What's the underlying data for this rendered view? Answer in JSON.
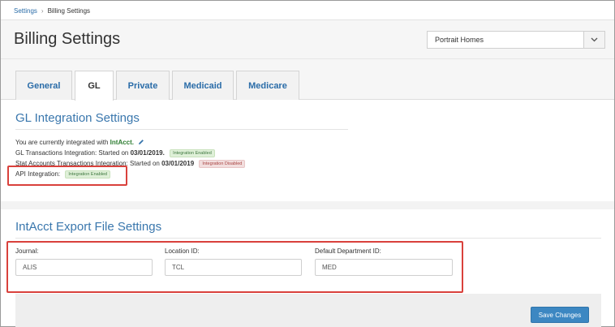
{
  "breadcrumb": {
    "parent": "Settings",
    "separator": "›",
    "current": "Billing Settings"
  },
  "header": {
    "title": "Billing Settings",
    "organization": "Portrait Homes"
  },
  "tabs": [
    {
      "label": "General",
      "active": false
    },
    {
      "label": "GL",
      "active": true
    },
    {
      "label": "Private",
      "active": false
    },
    {
      "label": "Medicaid",
      "active": false
    },
    {
      "label": "Medicare",
      "active": false
    }
  ],
  "gl_section": {
    "title": "GL Integration Settings",
    "integrated_prefix": "You are currently integrated with ",
    "integrated_name": "IntAcct.",
    "gl_transactions_prefix": "GL Transactions Integration: Started on ",
    "gl_transactions_date": "03/01/2019.",
    "gl_transactions_badge": "Integration Enabled",
    "stat_accounts_prefix": "Stat Accounts Transactions Integration: Started on ",
    "stat_accounts_date": "03/01/2019",
    "stat_accounts_badge": "Integration Disabled",
    "api_label": "API Integration:",
    "api_badge": "Integration Enabled"
  },
  "export_section": {
    "title": "IntAcct Export File Settings",
    "journal": {
      "label": "Journal:",
      "value": "ALIS"
    },
    "location": {
      "label": "Location ID:",
      "value": "TCL"
    },
    "department": {
      "label": "Default Department ID:",
      "value": "MED"
    }
  },
  "actions": {
    "save_label": "Save Changes"
  },
  "colors": {
    "accent": "#3a77ad",
    "highlight": "#d9413c",
    "enabled": "#dff0d8",
    "disabled": "#f2dede"
  }
}
